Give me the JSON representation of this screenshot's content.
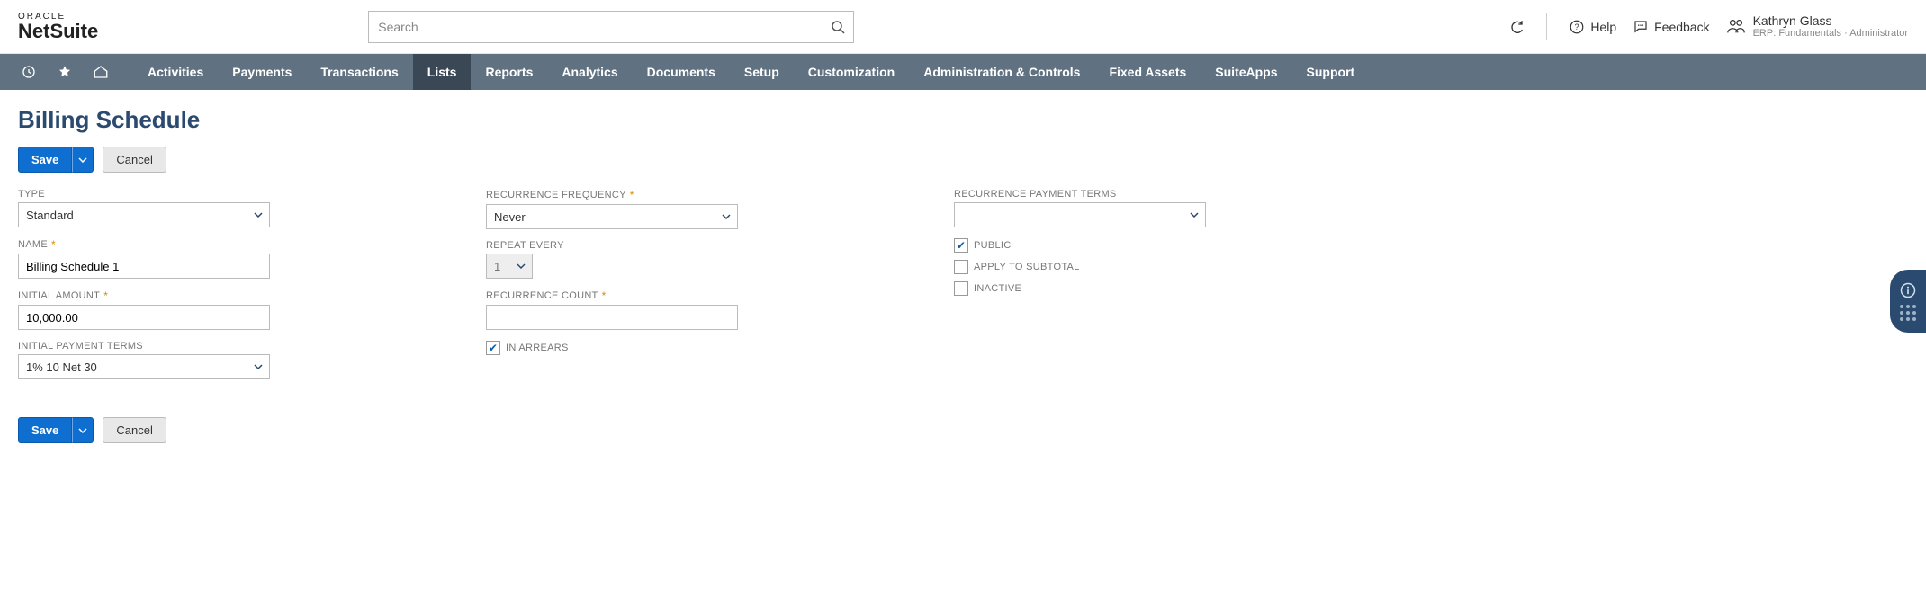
{
  "brand": {
    "top": "ORACLE",
    "bottom": "NetSuite"
  },
  "search": {
    "placeholder": "Search"
  },
  "header_links": {
    "help": "Help",
    "feedback": "Feedback"
  },
  "user": {
    "name": "Kathryn Glass",
    "role": "ERP: Fundamentals · Administrator"
  },
  "nav": {
    "items": [
      "Activities",
      "Payments",
      "Transactions",
      "Lists",
      "Reports",
      "Analytics",
      "Documents",
      "Setup",
      "Customization",
      "Administration & Controls",
      "Fixed Assets",
      "SuiteApps",
      "Support"
    ],
    "active": "Lists"
  },
  "page": {
    "title": "Billing Schedule"
  },
  "buttons": {
    "save": "Save",
    "cancel": "Cancel"
  },
  "form": {
    "col1": {
      "type_label": "TYPE",
      "type_value": "Standard",
      "name_label": "NAME",
      "name_value": "Billing Schedule 1",
      "initial_amount_label": "INITIAL AMOUNT",
      "initial_amount_value": "10,000.00",
      "initial_terms_label": "INITIAL PAYMENT TERMS",
      "initial_terms_value": "1% 10 Net 30"
    },
    "col2": {
      "recur_freq_label": "RECURRENCE FREQUENCY",
      "recur_freq_value": "Never",
      "repeat_label": "REPEAT EVERY",
      "repeat_value": "1",
      "recur_count_label": "RECURRENCE COUNT",
      "recur_count_value": "",
      "in_arrears_label": "IN ARREARS",
      "in_arrears_checked": true
    },
    "col3": {
      "recur_terms_label": "RECURRENCE PAYMENT TERMS",
      "recur_terms_value": "",
      "public_label": "PUBLIC",
      "public_checked": true,
      "apply_subtotal_label": "APPLY TO SUBTOTAL",
      "apply_subtotal_checked": false,
      "inactive_label": "INACTIVE",
      "inactive_checked": false
    }
  }
}
